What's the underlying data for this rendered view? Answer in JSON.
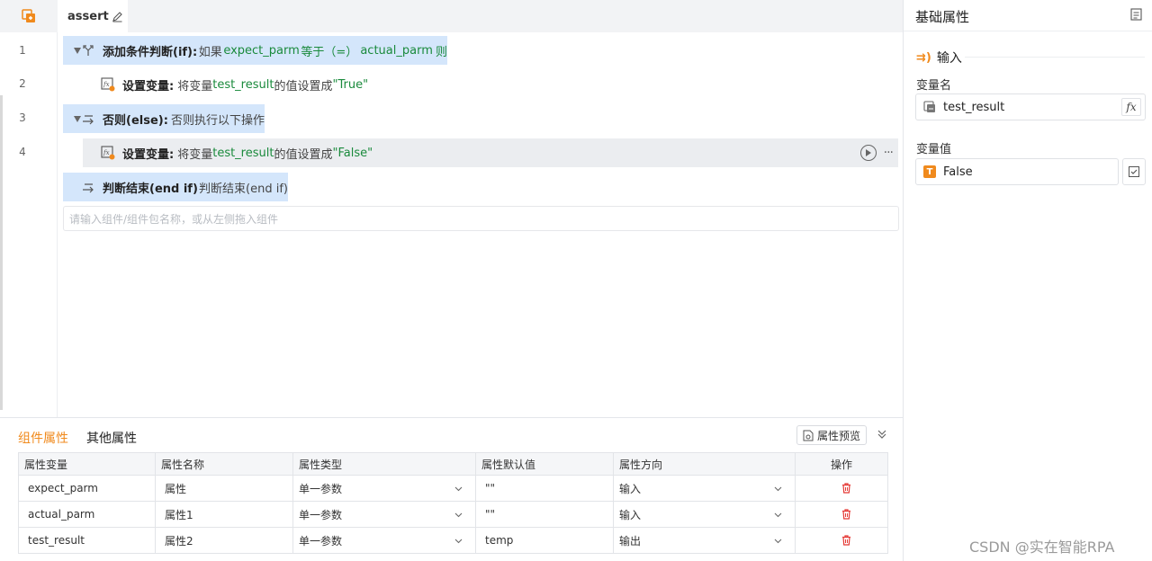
{
  "tab": {
    "title": "assert"
  },
  "lines": [
    {
      "no": "1",
      "keyword": "添加条件判断(if):",
      "pre": "如果",
      "var1": "expect_parm",
      "mid": "等于（=）",
      "var2": "actual_parm",
      "post": "则"
    },
    {
      "no": "2",
      "keyword": "设置变量:",
      "pre": "将变量",
      "var": "test_result",
      "mid": "的值设置成",
      "value": "\"True\""
    },
    {
      "no": "3",
      "keyword": "否则(else):",
      "desc": "否则执行以下操作"
    },
    {
      "no": "4",
      "keyword": "设置变量:",
      "pre": "将变量",
      "var": "test_result",
      "mid": "的值设置成",
      "value": "\"False\"",
      "more": "···"
    },
    {
      "keyword": "判断结束(end if)",
      "desc": "判断结束(end if)"
    }
  ],
  "component_search": {
    "placeholder": "请输入组件/组件包名称，或从左侧拖入组件"
  },
  "bottom": {
    "tabs": [
      "组件属性",
      "其他属性"
    ],
    "preview_label": "属性预览",
    "columns": [
      "属性变量",
      "属性名称",
      "属性类型",
      "属性默认值",
      "属性方向",
      "操作"
    ],
    "rows": [
      {
        "var": "expect_parm",
        "name": "属性",
        "type": "单一参数",
        "default": "\"\"",
        "direction": "输入"
      },
      {
        "var": "actual_parm",
        "name": "属性1",
        "type": "单一参数",
        "default": "\"\"",
        "direction": "输入"
      },
      {
        "var": "test_result",
        "name": "属性2",
        "type": "单一参数",
        "default": "temp",
        "direction": "输出"
      }
    ]
  },
  "right_panel": {
    "title": "基础属性",
    "section": "输入",
    "section_icon": "⇉)",
    "var_name_label": "变量名",
    "var_name_value": "test_result",
    "fx_label": "fx",
    "var_value_label": "变量值",
    "var_value": "False",
    "type_badge": "T"
  },
  "watermark": "CSDN @实在智能RPA",
  "colors": {
    "accent": "#f08a1d",
    "highlight": "#d4e6fb",
    "variable": "#1a8a3c",
    "danger": "#e53935"
  }
}
